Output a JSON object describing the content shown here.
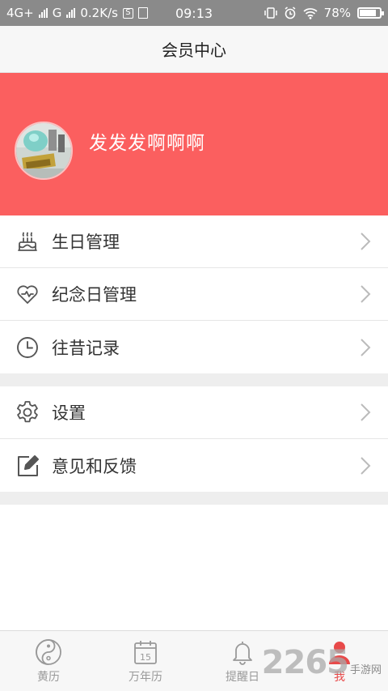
{
  "status_bar": {
    "network_1": "4G+",
    "network_2": "G",
    "speed": "0.2K/s",
    "time": "09:13",
    "battery_percent": "78%",
    "battery_level": 0.78
  },
  "header": {
    "title": "会员中心"
  },
  "profile": {
    "username": "发发发啊啊啊"
  },
  "menu_group_1": [
    {
      "label": "生日管理",
      "icon": "birthday-cake-icon"
    },
    {
      "label": "纪念日管理",
      "icon": "heart-icon"
    },
    {
      "label": "往昔记录",
      "icon": "clock-icon"
    }
  ],
  "menu_group_2": [
    {
      "label": "设置",
      "icon": "gear-icon"
    },
    {
      "label": "意见和反馈",
      "icon": "edit-icon"
    }
  ],
  "tab_bar": {
    "tabs": [
      {
        "label": "黄历",
        "icon": "yin-yang-icon"
      },
      {
        "label": "万年历",
        "icon": "calendar-icon",
        "calendar_day": "15"
      },
      {
        "label": "提醒日",
        "icon": "bell-icon"
      },
      {
        "label": "我",
        "icon": "user-icon"
      }
    ],
    "active_tab": 3
  },
  "watermark": {
    "number": "2265",
    "text": "手游网"
  },
  "colors": {
    "banner": "#fb5f5f",
    "active_tab": "#e84a4a",
    "icon": "#555555"
  }
}
